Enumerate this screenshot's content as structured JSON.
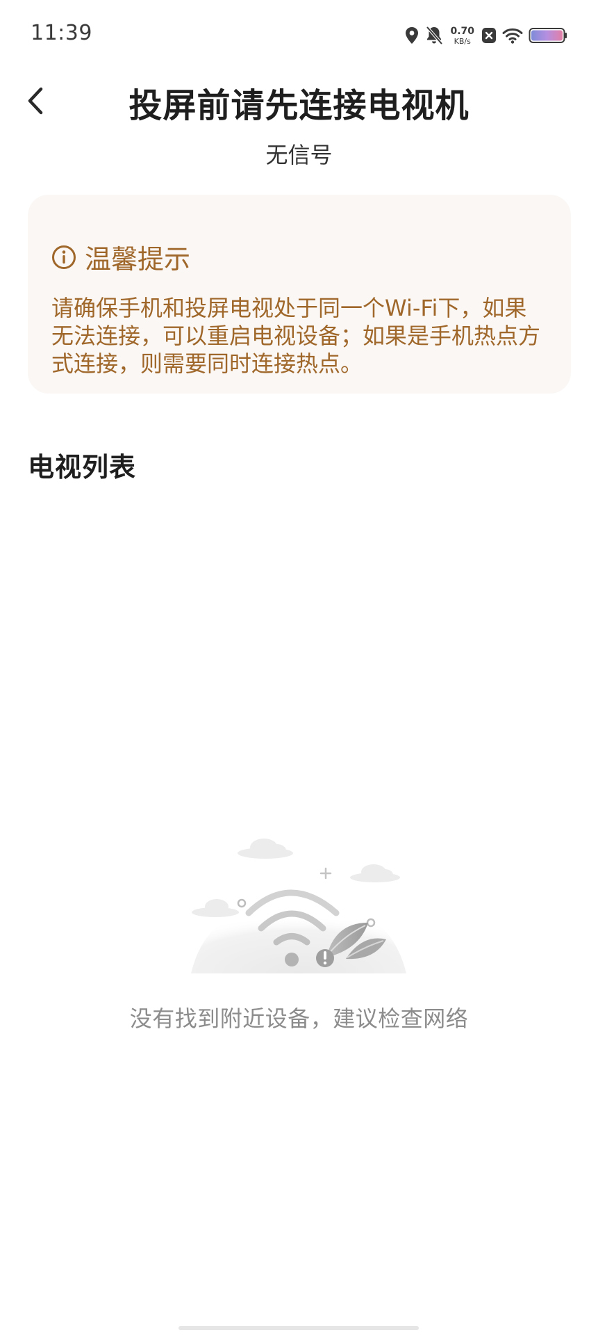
{
  "status_bar": {
    "time": "11:39",
    "net_speed_value": "0.70",
    "net_speed_unit": "KB/s",
    "icons": [
      "location-icon",
      "mute-bell-icon",
      "net-speed",
      "close-box-icon",
      "wifi-icon",
      "battery-icon"
    ]
  },
  "header": {
    "title": "投屏前请先连接电视机",
    "subtitle": "无信号"
  },
  "tip": {
    "title": "温馨提示",
    "body": "请确保手机和投屏电视处于同一个Wi-Fi下，如果无法连接，可以重启电视设备；如果是手机热点方式连接，则需要同时连接热点。",
    "icon": "info-icon",
    "color": "#a0672a",
    "background": "#faf7f5"
  },
  "tv_list": {
    "section_title": "电视列表",
    "items": []
  },
  "empty_state": {
    "message": "没有找到附近设备，建议检查网络",
    "illustration": "no-wifi-illustration"
  }
}
